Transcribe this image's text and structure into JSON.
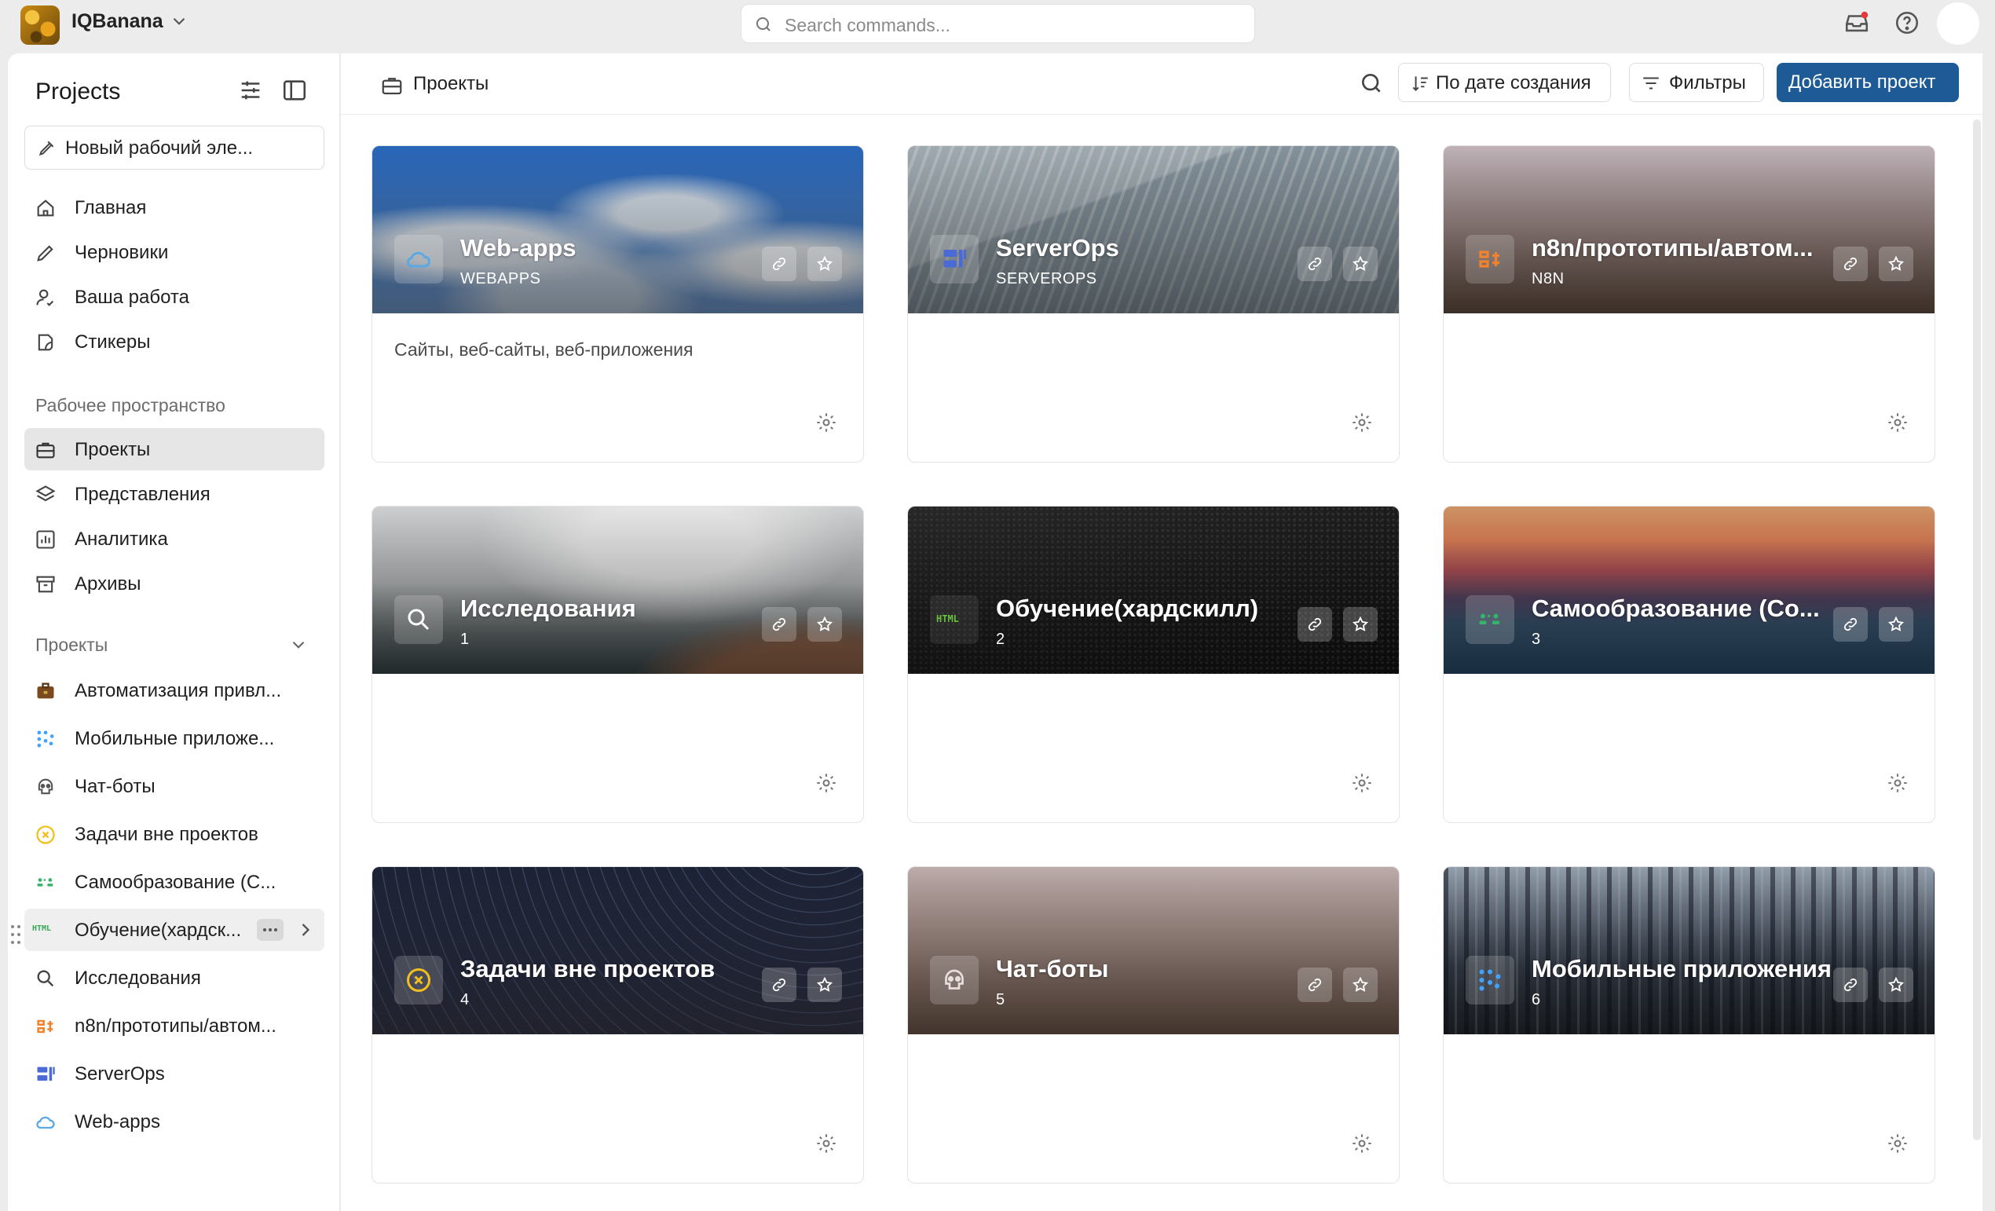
{
  "workspace": {
    "name": "IQBanana"
  },
  "search": {
    "placeholder": "Search commands..."
  },
  "sidebar": {
    "title": "Projects",
    "new_item": "Новый рабочий эле...",
    "nav": [
      {
        "label": "Главная",
        "icon": "home-icon"
      },
      {
        "label": "Черновики",
        "icon": "pen-icon"
      },
      {
        "label": "Ваша работа",
        "icon": "user-check-icon"
      },
      {
        "label": "Стикеры",
        "icon": "sticker-icon"
      }
    ],
    "workspace_section": "Рабочее пространство",
    "workspace_items": [
      {
        "label": "Проекты",
        "icon": "briefcase-icon",
        "active": true
      },
      {
        "label": "Представления",
        "icon": "layers-icon"
      },
      {
        "label": "Аналитика",
        "icon": "chart-icon"
      },
      {
        "label": "Архивы",
        "icon": "archive-icon"
      }
    ],
    "projects_section": "Проекты",
    "projects": [
      {
        "label": "Автоматизация привл...",
        "icon": "briefcase-emoji-icon"
      },
      {
        "label": "Мобильные приложе...",
        "icon": "dots-grid-icon"
      },
      {
        "label": "Чат-боты",
        "icon": "skull-icon"
      },
      {
        "label": "Задачи вне проектов",
        "icon": "x-circle-icon"
      },
      {
        "label": "Самообразование (С...",
        "icon": "people-icon"
      },
      {
        "label": "Обучение(хардск...",
        "icon": "html-icon"
      },
      {
        "label": "Исследования",
        "icon": "search-icon"
      },
      {
        "label": "n8n/прототипы/автом...",
        "icon": "n8n-icon"
      },
      {
        "label": "ServerOps",
        "icon": "server-icon"
      },
      {
        "label": "Web-apps",
        "icon": "cloud-icon"
      }
    ]
  },
  "main": {
    "title": "Проекты",
    "sort_label": "По дате создания",
    "filter_label": "Фильтры",
    "add_label": "Добавить проект"
  },
  "cards": [
    {
      "name": "Web-apps",
      "id": "WEBAPPS",
      "desc": "Сайты, веб-сайты, веб-приложения",
      "icon": "cloud-icon",
      "accent": "#5aa8e6"
    },
    {
      "name": "ServerOps",
      "id": "SERVEROPS",
      "desc": "",
      "icon": "server-icon",
      "accent": "#4a6bd6"
    },
    {
      "name": "n8n/прототипы/автом...",
      "id": "N8N",
      "desc": "",
      "icon": "n8n-icon",
      "accent": "#f0832e"
    },
    {
      "name": "Исследования",
      "id": "1",
      "desc": "",
      "icon": "search-icon",
      "accent": "#ffffff"
    },
    {
      "name": "Обучение(хардскилл)",
      "id": "2",
      "desc": "",
      "icon": "html-icon",
      "accent": "#67c23a"
    },
    {
      "name": "Самообразование (Со...",
      "id": "3",
      "desc": "",
      "icon": "people-icon",
      "accent": "#35b36b"
    },
    {
      "name": "Задачи вне проектов",
      "id": "4",
      "desc": "",
      "icon": "x-circle-icon",
      "accent": "#f2c01e"
    },
    {
      "name": "Чат-боты",
      "id": "5",
      "desc": "",
      "icon": "skull-icon",
      "accent": "#e9dede"
    },
    {
      "name": "Мобильные приложения",
      "id": "6",
      "desc": "",
      "icon": "dots-grid-icon",
      "accent": "#3fa3ff"
    }
  ],
  "colors": {
    "primary": "#1d5a96",
    "active_nav_bg": "#e6e6e6"
  }
}
